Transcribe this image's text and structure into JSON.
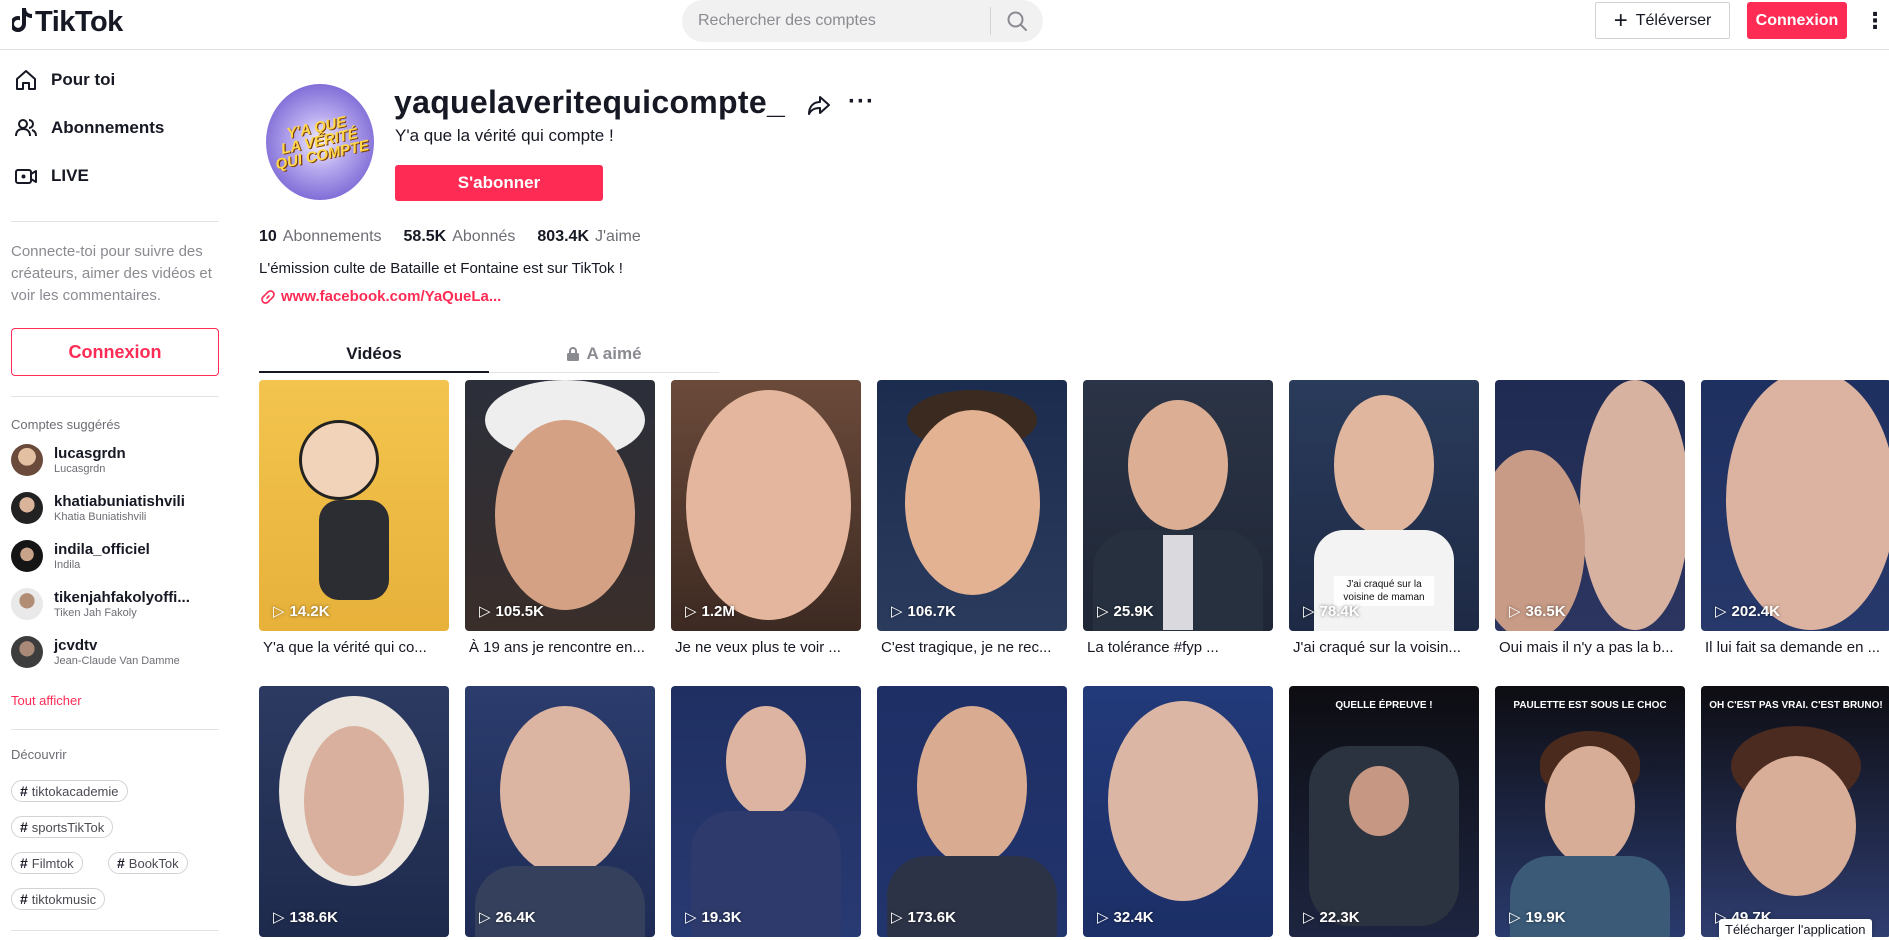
{
  "header": {
    "logo_text": "TikTok",
    "search_placeholder": "Rechercher des comptes",
    "upload_label": "Téléverser",
    "login_label": "Connexion"
  },
  "sidebar": {
    "nav": [
      {
        "label": "Pour toi",
        "icon": "home-icon"
      },
      {
        "label": "Abonnements",
        "icon": "users-icon"
      },
      {
        "label": "LIVE",
        "icon": "live-icon"
      }
    ],
    "login_prompt": "Connecte-toi pour suivre des créateurs, aimer des vidéos et voir les commentaires.",
    "login_button": "Connexion",
    "suggested_heading": "Comptes suggérés",
    "suggested": [
      {
        "name": "lucasgrdn",
        "sub": "Lucasgrdn"
      },
      {
        "name": "khatiabuniatishvili",
        "sub": "Khatia Buniatishvili"
      },
      {
        "name": "indila_officiel",
        "sub": "Indila"
      },
      {
        "name": "tikenjahfakolyoffi...",
        "sub": "Tiken Jah Fakoly"
      },
      {
        "name": "jcvdtv",
        "sub": "Jean-Claude Van Damme"
      }
    ],
    "see_all": "Tout afficher",
    "discover_heading": "Découvrir",
    "tags": [
      "tiktokacademie",
      "sportsTikTok",
      "Filmtok",
      "BookTok",
      "tiktokmusic"
    ]
  },
  "profile": {
    "username": "yaquelaveritequicompte_",
    "nickname": "Y'a que la vérité qui compte !",
    "follow_button": "S'abonner",
    "avatar_text": [
      "Y'A QUE",
      "LA VÉRITÉ",
      "QUI COMPTE"
    ],
    "stats": [
      {
        "value": "10",
        "label": "Abonnements"
      },
      {
        "value": "58.5K",
        "label": "Abonnés"
      },
      {
        "value": "803.4K",
        "label": "J'aime"
      }
    ],
    "bio": "L'émission culte de Bataille et Fontaine est sur TikTok !",
    "link": "www.facebook.com/YaQueLa..."
  },
  "tabs": {
    "videos": "Vidéos",
    "liked": "A aimé"
  },
  "videos": [
    {
      "views": "14.2K",
      "caption": "Y'a que la vérité qui co..."
    },
    {
      "views": "105.5K",
      "caption": "À 19 ans je rencontre en..."
    },
    {
      "views": "1.2M",
      "caption": "Je ne veux plus te voir ..."
    },
    {
      "views": "106.7K",
      "caption": "C'est tragique, je ne rec..."
    },
    {
      "views": "25.9K",
      "caption": "La tolérance #fyp ..."
    },
    {
      "views": "78.4K",
      "caption": "J'ai craqué sur la voisin...",
      "overlay": "J'ai craqué sur la voisine de maman"
    },
    {
      "views": "36.5K",
      "caption": "Oui mais il n'y a pas la b..."
    },
    {
      "views": "202.4K",
      "caption": "Il lui fait sa demande en ..."
    },
    {
      "views": "138.6K"
    },
    {
      "views": "26.4K"
    },
    {
      "views": "19.3K"
    },
    {
      "views": "173.6K"
    },
    {
      "views": "32.4K"
    },
    {
      "views": "22.3K",
      "overlay": "QUELLE ÉPREUVE !"
    },
    {
      "views": "19.9K",
      "overlay": "PAULETTE EST SOUS LE CHOC"
    },
    {
      "views": "49.7K",
      "overlay": "OH C'EST PAS VRAI. C'EST BRUNO!"
    }
  ],
  "app_banner": "Télécharger l'application",
  "colors": {
    "accent": "#fe2c55",
    "text": "#161823",
    "muted": "#8a8b91"
  }
}
